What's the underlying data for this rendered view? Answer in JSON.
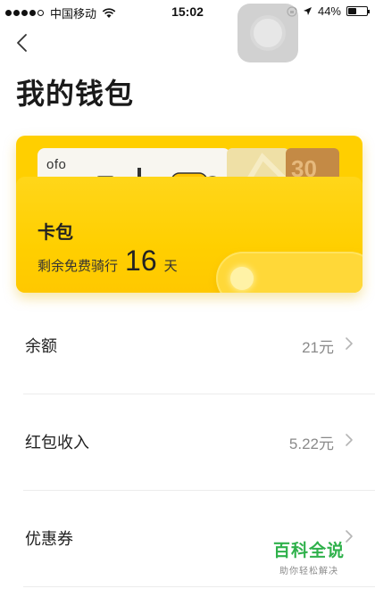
{
  "status_bar": {
    "carrier": "中国移动",
    "time": "15:02",
    "battery_text": "44%",
    "battery_level": 0.44,
    "signal_bars_filled": 4,
    "signal_bars_total": 5
  },
  "header": {
    "title": "我的钱包"
  },
  "wallet_card": {
    "brand_label": "ofo",
    "brown_card_glyph": "30",
    "title": "卡包",
    "free_ride_label": "剩余免费骑行",
    "free_ride_days": "16",
    "free_ride_unit": "天"
  },
  "rows": [
    {
      "label": "余额",
      "value": "21元"
    },
    {
      "label": "红包收入",
      "value": "5.22元"
    },
    {
      "label": "优惠券",
      "value": ""
    }
  ],
  "watermark": {
    "main": "百科全说",
    "sub": "助你轻松解决"
  },
  "colors": {
    "accent_yellow": "#ffcf00",
    "watermark_green": "#2fb14b"
  },
  "icons": {
    "back": "chevron-left-icon",
    "row_arrow": "chevron-right-icon",
    "location": "location-arrow-icon",
    "wifi": "wifi-icon"
  }
}
